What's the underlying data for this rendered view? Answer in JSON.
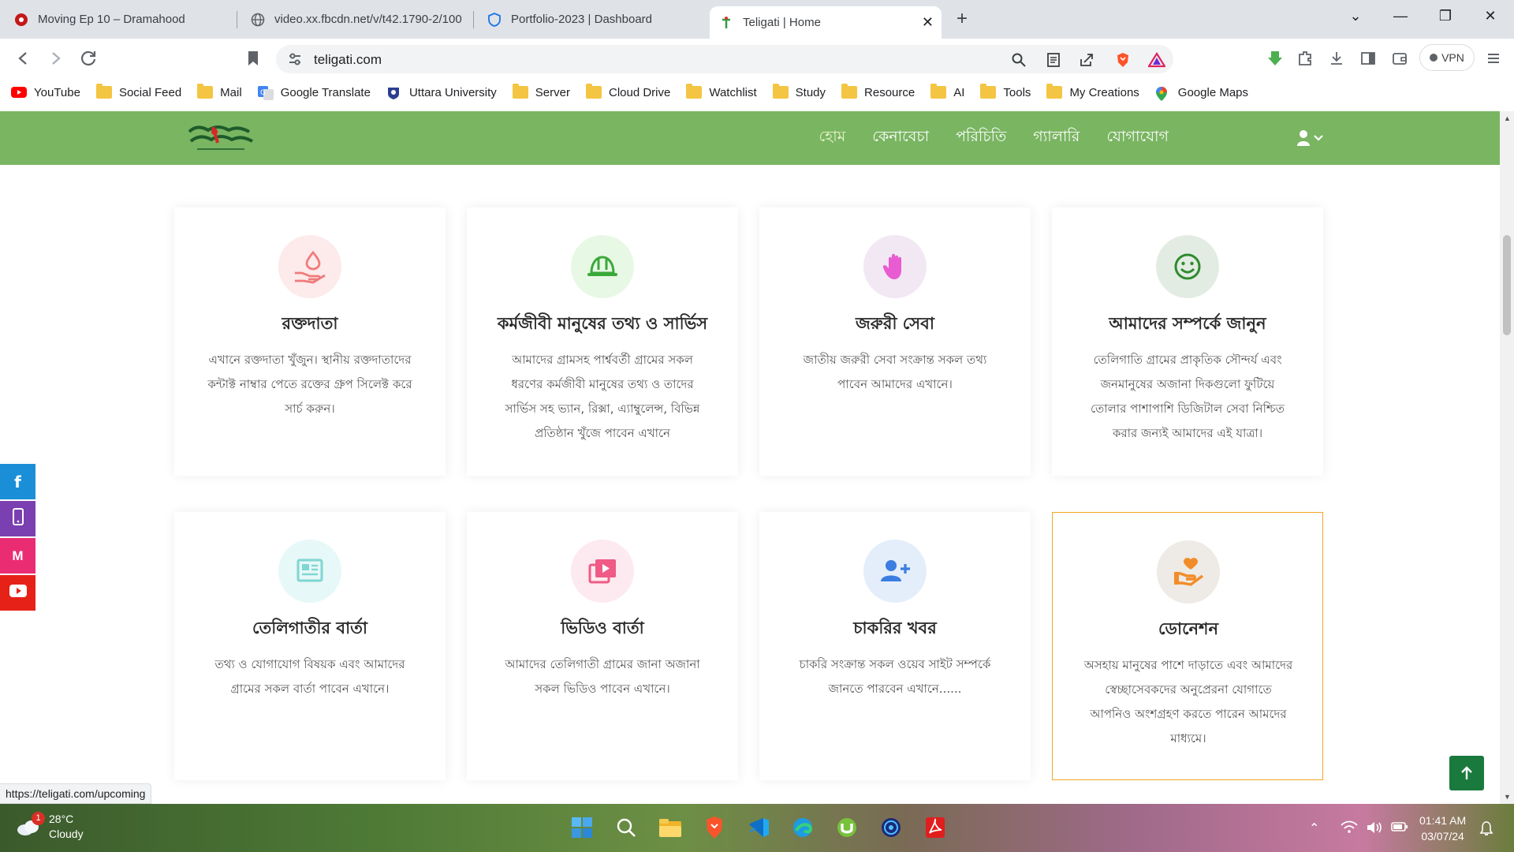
{
  "browser": {
    "tabs": [
      {
        "title": "Moving Ep 10 – Dramahood",
        "active": false
      },
      {
        "title": "video.xx.fbcdn.net/v/t42.1790-2/100",
        "active": false
      },
      {
        "title": "Portfolio-2023 | Dashboard",
        "active": false
      },
      {
        "title": "Teligati | Home",
        "active": true
      }
    ],
    "new_tab": "+",
    "close_tab": "✕",
    "url": "teligati.com",
    "vpn_label": "VPN",
    "window_controls": {
      "minimize": "—",
      "restore": "❐",
      "close": "✕",
      "tab_search": "⌄"
    }
  },
  "bookmarks": [
    {
      "label": "YouTube",
      "icon": "youtube-icon"
    },
    {
      "label": "Social Feed",
      "icon": "folder-icon"
    },
    {
      "label": "Mail",
      "icon": "folder-icon"
    },
    {
      "label": "Google Translate",
      "icon": "translate-icon"
    },
    {
      "label": "Uttara University",
      "icon": "university-icon"
    },
    {
      "label": "Server",
      "icon": "folder-icon"
    },
    {
      "label": "Cloud Drive",
      "icon": "folder-icon"
    },
    {
      "label": "Watchlist",
      "icon": "folder-icon"
    },
    {
      "label": "Study",
      "icon": "folder-icon"
    },
    {
      "label": "Resource",
      "icon": "folder-icon"
    },
    {
      "label": "AI",
      "icon": "folder-icon"
    },
    {
      "label": "Tools",
      "icon": "folder-icon"
    },
    {
      "label": "My Creations",
      "icon": "folder-icon"
    },
    {
      "label": "Google Maps",
      "icon": "maps-icon"
    }
  ],
  "site": {
    "nav": [
      {
        "label": "হোম",
        "active": true
      },
      {
        "label": "কেনাবেচা",
        "active": false
      },
      {
        "label": "পরিচিতি",
        "active": false
      },
      {
        "label": "গ্যালারি",
        "active": false
      },
      {
        "label": "যোগাযোগ",
        "active": false
      }
    ],
    "cards": [
      {
        "title": "রক্তদাতা",
        "desc": "এখানে রক্তদাতা খুঁজুন। স্থানীয় রক্তদাতাদের কন্টাক্ট নাম্বার পেতে রক্তের গ্রুপ সিলেক্ট করে সার্চ করুন।",
        "icon": "blood-donation-icon",
        "icon_color": "#f07b7b",
        "bg": "#fdeaea"
      },
      {
        "title": "কর্মজীবী মানুষের তথ্য ও সার্ভিস",
        "desc": "আমাদের গ্রামসহ পার্শ্ববর্তী গ্রামের সকল ধরণের কর্মজীবী মানুষের তথ্য ও তাদের সার্ভিস সহ ভ্যান, রিক্সা, এ্যাম্বুলেন্স, বিভিন্ন প্রতিষ্ঠান খুঁজে পাবেন এখানে",
        "icon": "hard-hat-icon",
        "icon_color": "#3aa93a",
        "bg": "#e7f8e4"
      },
      {
        "title": "জরুরী সেবা",
        "desc": "জাতীয় জরুরী সেবা সংক্রান্ত সকল তথ্য পাবেন আমাদের এখানে।",
        "icon": "hand-icon",
        "icon_color": "#e85bd1",
        "bg": "#f1e8f3"
      },
      {
        "title": "আমাদের সম্পর্কে জানুন",
        "desc": "তেলিগাতি গ্রামের প্রাকৃতিক সৌন্দর্য এবং জনমানুষের অজানা দিকগুলো ফুটিয়ে তোলার পাশাপাশি ডিজিটাল সেবা নিশ্চিত করার জন্যই আমাদের এই যাত্রা।",
        "icon": "smile-icon",
        "icon_color": "#2e8b2e",
        "bg": "#e3ece3"
      },
      {
        "title": "তেলিগাতীর বার্তা",
        "desc": "তথ্য ও যোগাযোগ বিষয়ক এবং আমাদের গ্রামের সকল বার্তা পাবেন এখানে।",
        "icon": "newspaper-icon",
        "icon_color": "#7fd6d4",
        "bg": "#e6f8f7"
      },
      {
        "title": "ভিডিও বার্তা",
        "desc": "আমাদের তেলিগাতী গ্রামের জানা অজানা সকল ভিডিও পাবেন এখানে।",
        "icon": "video-icon",
        "icon_color": "#ef5b86",
        "bg": "#fdeaf0"
      },
      {
        "title": "চাকরির খবর",
        "desc": "চাকরি সংক্রান্ত সকল ওয়েব সাইট সম্পর্কে জানতে পারবেন এখানে......",
        "icon": "add-user-icon",
        "icon_color": "#3b7de0",
        "bg": "#e4eefb"
      },
      {
        "title": "ডোনেশন",
        "desc": "অসহায় মানুষের পাশে দাড়াতে এবং আমাদের স্বেচ্ছাসেবকদের অনুপ্রেরনা যোগাতে আপনিও অংশগ্রহণ করতে পারেন আমদের মাধ্যমে।",
        "icon": "donate-icon",
        "icon_color": "#f28c28",
        "bg": "#eeeae6"
      }
    ],
    "social": [
      {
        "label": "f",
        "icon": "facebook-icon",
        "color": "#1a8fd8"
      },
      {
        "label": "▯",
        "icon": "phone-icon",
        "color": "#7a3fb0"
      },
      {
        "label": "M",
        "icon": "gmail-icon",
        "color": "#ea2c73"
      },
      {
        "label": "▶",
        "icon": "youtube-icon",
        "color": "#e62117"
      }
    ],
    "back_to_top": "↑"
  },
  "status_url": "https://teligati.com/upcoming",
  "taskbar": {
    "temperature": "28°C",
    "condition": "Cloudy",
    "weather_badge": "1",
    "time": "01:41 AM",
    "date": "03/07/24"
  }
}
